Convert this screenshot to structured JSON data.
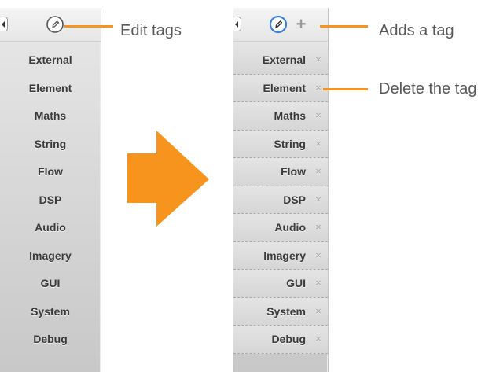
{
  "colors": {
    "accent": "#f7941d",
    "edit_active": "#3b82d9",
    "text": "#3a3a3a",
    "callout_text": "#595959"
  },
  "icons": {
    "edit": "pencil-icon",
    "add": "plus-icon",
    "delete": "close-icon",
    "collapse": "chevron-left-icon",
    "transition": "arrow-right-icon"
  },
  "left_panel": {
    "edit_state": "inactive",
    "tags": [
      "External",
      "Element",
      "Maths",
      "String",
      "Flow",
      "DSP",
      "Audio",
      "Imagery",
      "GUI",
      "System",
      "Debug"
    ]
  },
  "right_panel": {
    "edit_state": "active",
    "add_label": "+",
    "delete_label": "×",
    "tags": [
      "External",
      "Element",
      "Maths",
      "String",
      "Flow",
      "DSP",
      "Audio",
      "Imagery",
      "GUI",
      "System",
      "Debug"
    ]
  },
  "callouts": {
    "edit_tags": "Edit tags",
    "adds_tag": "Adds a tag",
    "delete_tag": "Delete the tag"
  }
}
